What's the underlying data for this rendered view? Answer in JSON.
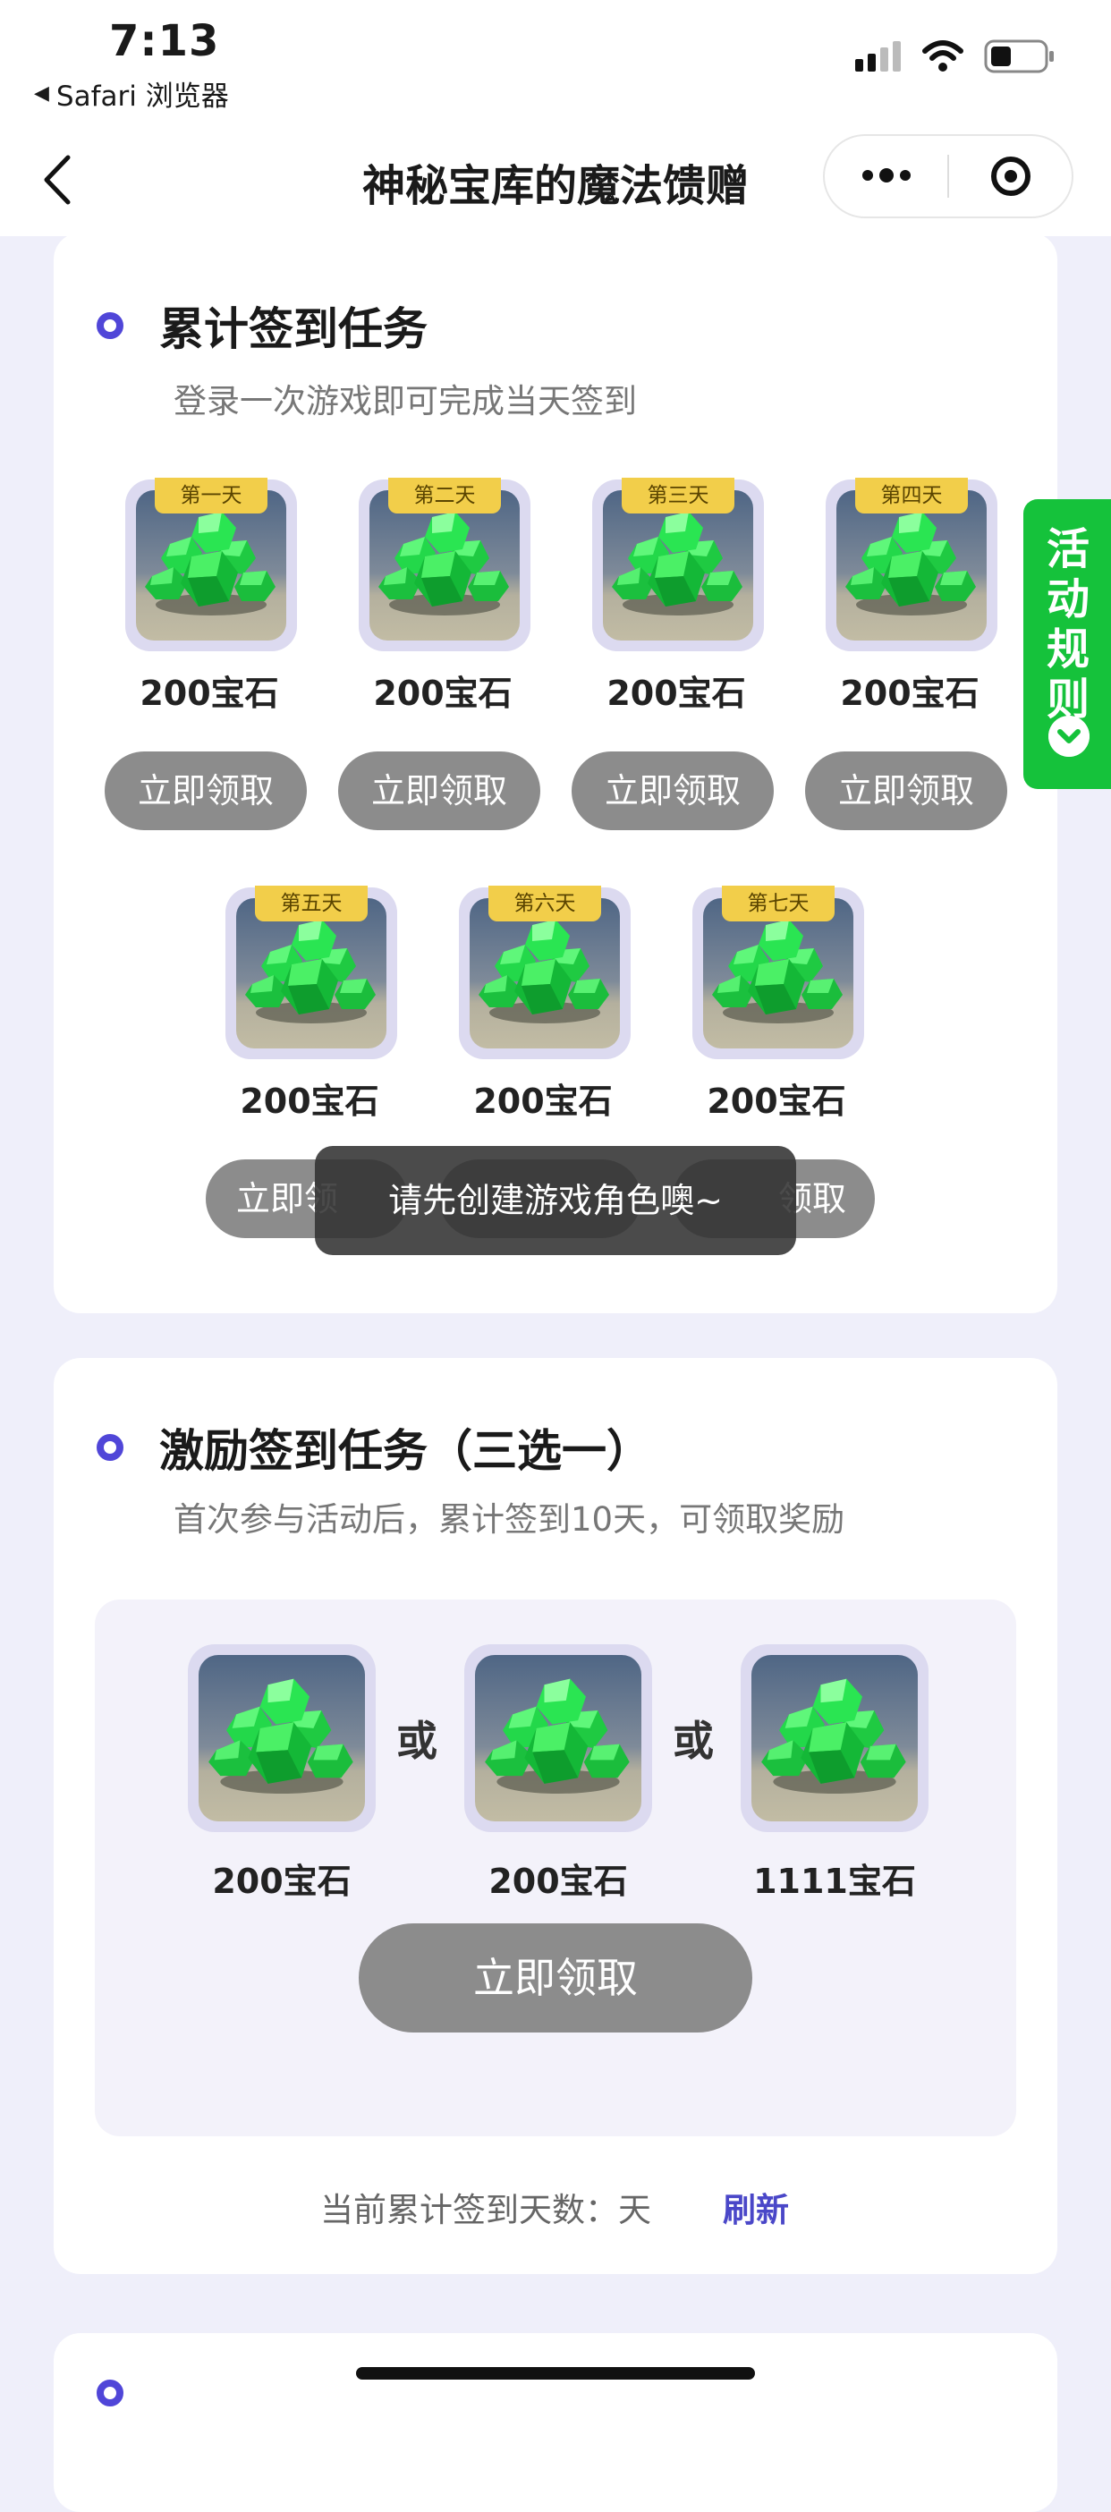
{
  "status_bar": {
    "time": "7:13",
    "back_app_label": "Safari 浏览器"
  },
  "nav": {
    "title": "神秘宝库的魔法馈赠"
  },
  "cumulative_section": {
    "title": "累计签到任务",
    "subtitle": "登录一次游戏即可完成当天签到",
    "days": [
      {
        "day_label": "第一天",
        "amount": "200宝石",
        "button": "立即领取"
      },
      {
        "day_label": "第二天",
        "amount": "200宝石",
        "button": "立即领取"
      },
      {
        "day_label": "第三天",
        "amount": "200宝石",
        "button": "立即领取"
      },
      {
        "day_label": "第四天",
        "amount": "200宝石",
        "button": "立即领取"
      },
      {
        "day_label": "第五天",
        "amount": "200宝石",
        "button": "立即领取"
      },
      {
        "day_label": "第六天",
        "amount": "200宝石",
        "button": "立即领取"
      },
      {
        "day_label": "第七天",
        "amount": "200宝石",
        "button": "立即领取"
      }
    ],
    "row2_button_left_visible": "立即领",
    "row2_button_right_visible": "领取"
  },
  "toast": {
    "text": "请先创建游戏角色噢~"
  },
  "incentive_section": {
    "title": "激励签到任务（三选一）",
    "subtitle": "首次参与活动后，累计签到10天，可领取奖励",
    "options": [
      {
        "amount": "200宝石"
      },
      {
        "amount": "200宝石"
      },
      {
        "amount": "1111宝石"
      }
    ],
    "or_label": "或",
    "claim_button": "立即领取",
    "count_label": "当前累计签到天数：天",
    "refresh_label": "刷新"
  },
  "rules_tab": {
    "label": "活动规则"
  },
  "colors": {
    "accent": "#5046d8",
    "rules_green": "#15c23b",
    "button_gray": "#8c8c8c",
    "tag_yellow": "#f2ce4a"
  }
}
